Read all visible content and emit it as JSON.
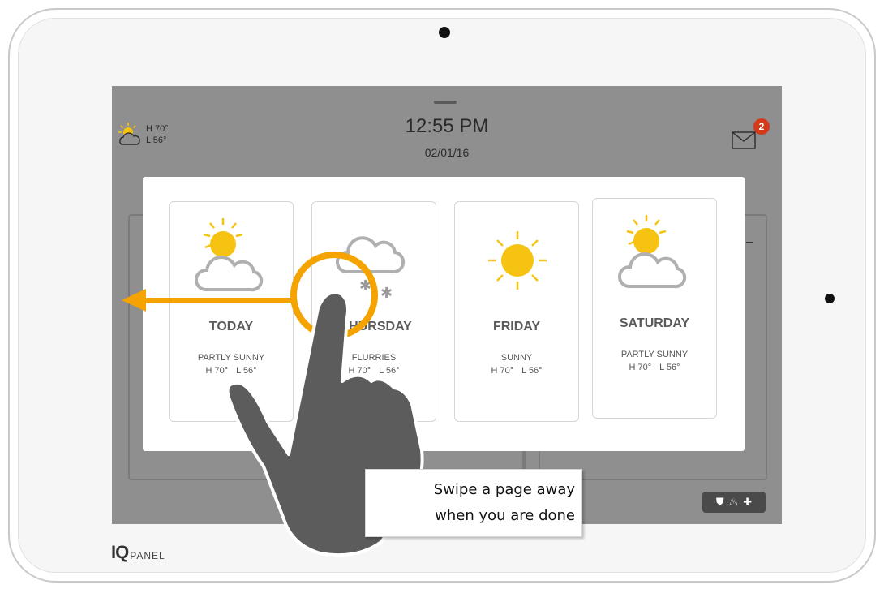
{
  "header": {
    "time": "12:55 PM",
    "date": "02/01/16",
    "weather_summary": {
      "high": "H 70°",
      "low": "L 56°",
      "icon": "partly-sunny-icon"
    },
    "messages": {
      "icon": "envelope-icon",
      "badge_count": "2"
    }
  },
  "forecast": {
    "cards": [
      {
        "day": "TODAY",
        "condition": "PARTLY SUNNY",
        "high": "H 70°",
        "low": "L 56°",
        "icon": "partly-sunny-icon"
      },
      {
        "day": "HURSDAY",
        "condition": "FLURRIES",
        "high": "H 70°",
        "low": "L 56°",
        "icon": "flurries-icon"
      },
      {
        "day": "FRIDAY",
        "condition": "SUNNY",
        "high": "H 70°",
        "low": "L 56°",
        "icon": "sunny-icon"
      },
      {
        "day": "SATURDAY",
        "condition": "PARTLY SUNNY",
        "high": "H 70°",
        "low": "L 56°",
        "icon": "partly-sunny-icon"
      }
    ]
  },
  "status_icons": [
    "shield-icon",
    "flame-icon",
    "medical-cross-icon"
  ],
  "callout": {
    "line1": "Swipe a page away",
    "line2": "when you are done"
  },
  "brand": {
    "mark": "IQ",
    "text": "PANEL"
  },
  "colors": {
    "sun": "#f7c312",
    "cloud": "#b0b0b0",
    "gesture_accent": "#f5a300",
    "hand": "#5a5a5a",
    "badge": "#d43a1a"
  }
}
